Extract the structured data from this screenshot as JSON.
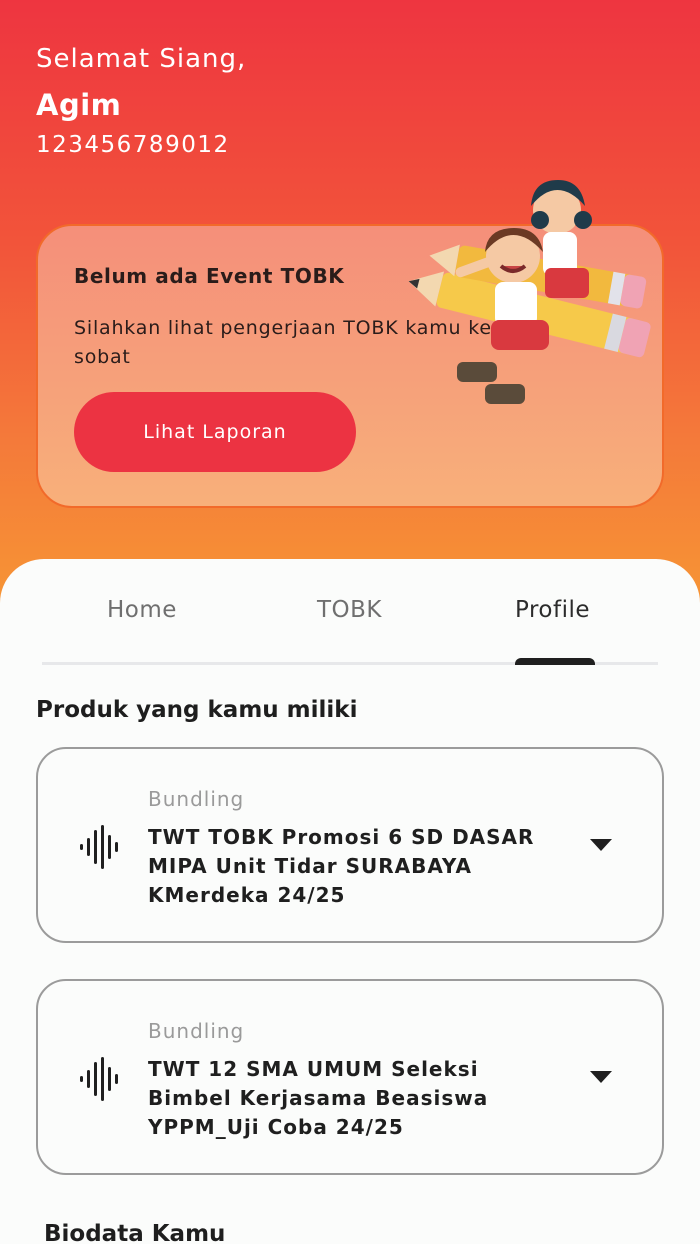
{
  "header": {
    "greeting": "Selamat Siang,",
    "name": "Agim",
    "user_id": "123456789012"
  },
  "event_card": {
    "title": "Belum ada Event TOBK",
    "description": "Silahkan lihat pengerjaan TOBK kamu kemaren ya, sobat",
    "button_label": "Lihat Laporan"
  },
  "tabs": [
    {
      "label": "Home",
      "active": false
    },
    {
      "label": "TOBK",
      "active": false
    },
    {
      "label": "Profile",
      "active": true
    }
  ],
  "products": {
    "title": "Produk yang kamu miliki",
    "items": [
      {
        "type": "Bundling",
        "name": "TWT TOBK Promosi 6 SD DASAR MIPA Unit Tidar SURABAYA KMerdeka 24/25",
        "icon": "audio-wave-icon"
      },
      {
        "type": "Bundling",
        "name": "TWT 12 SMA UMUM Seleksi Bimbel Kerjasama Beasiswa YPPM_Uji Coba 24/25",
        "icon": "audio-wave-icon"
      }
    ]
  },
  "biodata": {
    "title": "Biodata Kamu"
  },
  "colors": {
    "primary": "#ec3342",
    "gradient_top": "#ee3540",
    "gradient_bottom": "#f8a232"
  }
}
